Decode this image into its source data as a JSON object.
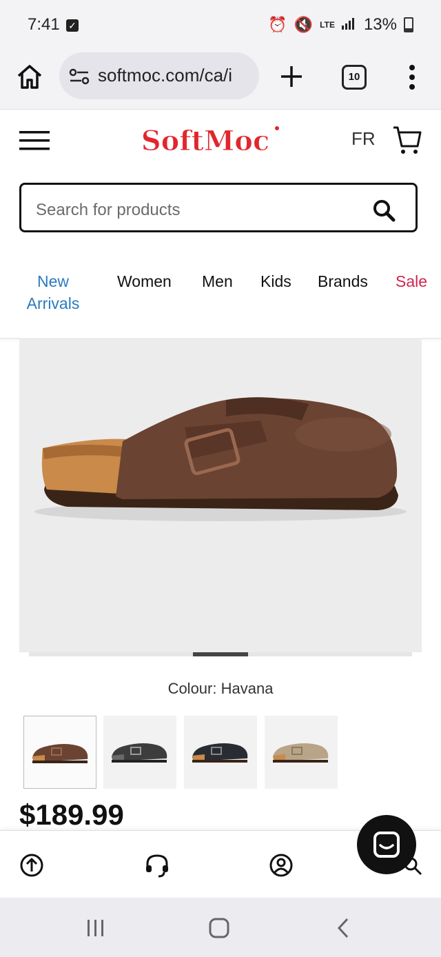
{
  "status_bar": {
    "time": "7:41",
    "network": "LTE",
    "battery": "13%"
  },
  "browser": {
    "url": "softmoc.com/ca/i",
    "tab_count": "10"
  },
  "header": {
    "logo_text": "SoftMoc",
    "lang_label": "FR"
  },
  "search": {
    "placeholder": "Search for products"
  },
  "nav": {
    "items": [
      {
        "label": "New Arrivals"
      },
      {
        "label": "Women"
      },
      {
        "label": "Men"
      },
      {
        "label": "Kids"
      },
      {
        "label": "Brands"
      },
      {
        "label": "Sale"
      }
    ]
  },
  "product": {
    "colour_label": "Colour: Havana",
    "price": "$189.99",
    "thumbnails": [
      "havana",
      "dark-grey",
      "black",
      "taupe"
    ]
  },
  "colors": {
    "brand_red": "#e1262d",
    "link_blue": "#2a7bbf",
    "sale_red": "#d0254f"
  }
}
